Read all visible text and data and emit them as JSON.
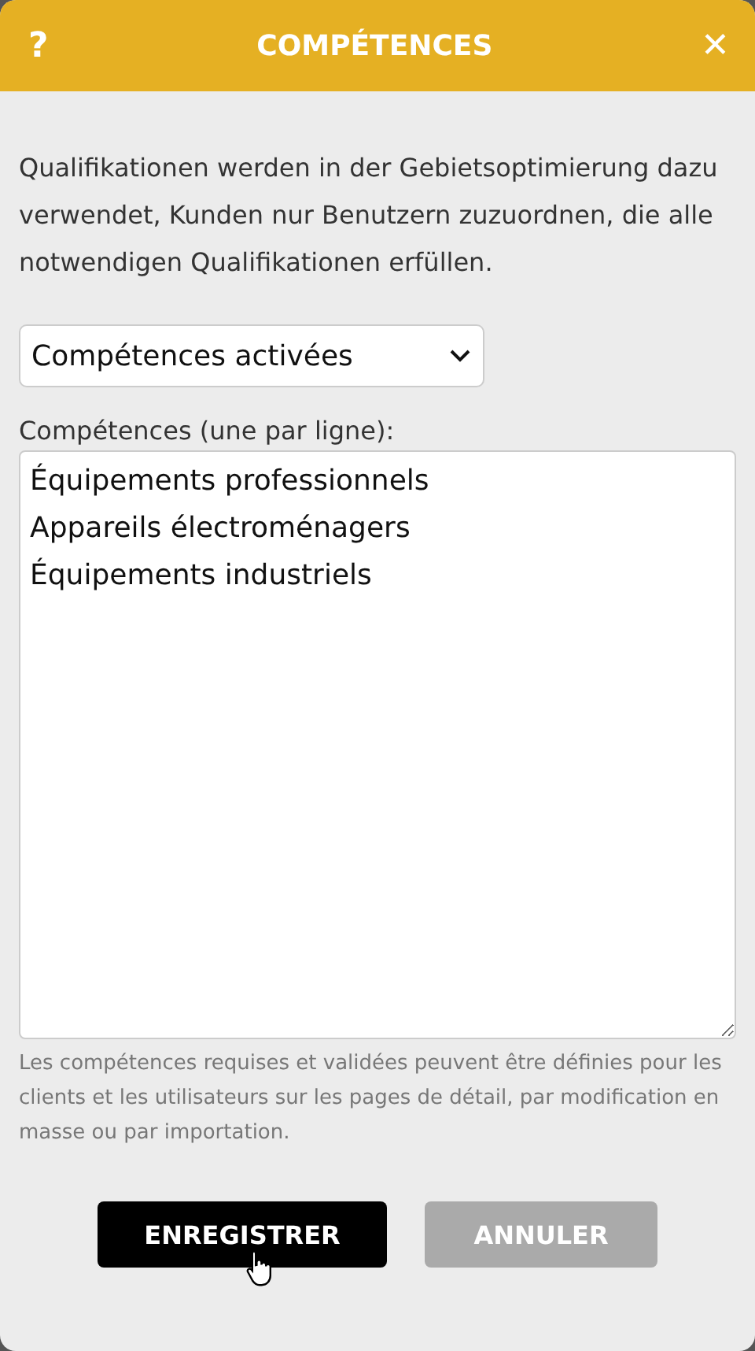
{
  "header": {
    "help": "?",
    "title": "COMPÉTENCES",
    "close": "✕"
  },
  "intro": "Qualifikationen werden in der Gebietsoptimierung dazu verwendet, Kunden nur Benutzern zuzuordnen, die alle notwendigen Qualifikationen erfüllen.",
  "mode_select": {
    "value": "Compétences activées"
  },
  "skills_field": {
    "label": "Compétences (une par ligne):",
    "lines": [
      "Équipements professionnels",
      "Appareils électroménagers",
      "Équipements industriels"
    ]
  },
  "hint": "Les compétences requises et validées peuvent être définies pour les clients et les utilisateurs sur les pages de détail, par modification en masse ou par importation.",
  "buttons": [
    {
      "label": "ENREGISTRER",
      "kind": "primary"
    },
    {
      "label": "ANNULER",
      "kind": "secondary"
    }
  ]
}
